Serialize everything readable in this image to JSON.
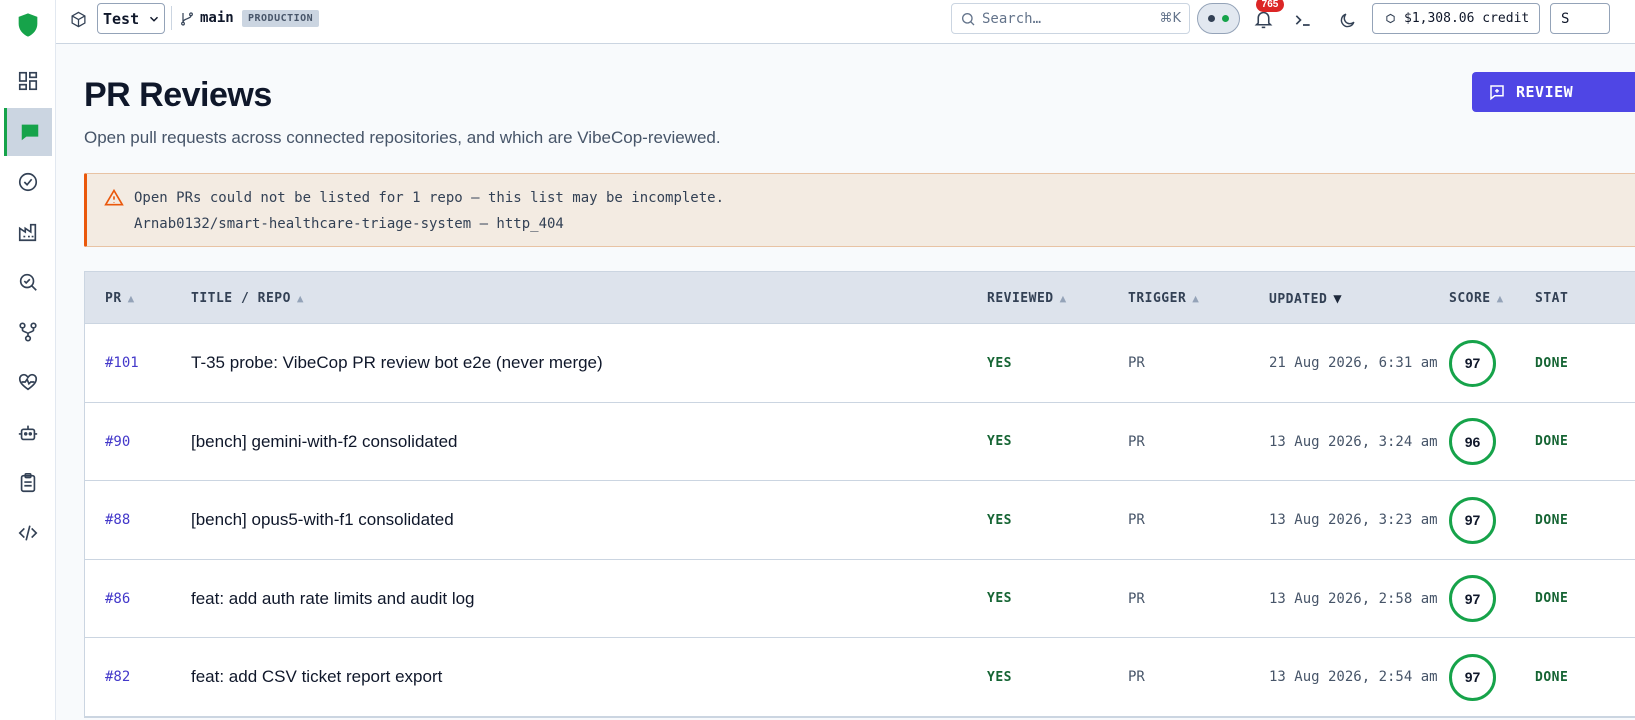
{
  "topbar": {
    "project": "Test",
    "branch": "main",
    "environment": "PRODUCTION",
    "search_placeholder": "Search…",
    "search_shortcut": "⌘K",
    "notification_count": "765",
    "credit": "$1,308.06 credit",
    "user_initial": "S"
  },
  "page": {
    "title": "PR Reviews",
    "subtitle": "Open pull requests across connected repositories, and which are VibeCop-reviewed.",
    "review_button": "REVIEW"
  },
  "alert": {
    "message": "Open PRs could not be listed for 1 repo — this list may be incomplete.",
    "detail": "Arnab0132/smart-healthcare-triage-system — http_404"
  },
  "table": {
    "columns": [
      "PR",
      "TITLE / REPO",
      "REVIEWED",
      "TRIGGER",
      "UPDATED",
      "SCORE",
      "STAT"
    ],
    "rows": [
      {
        "pr": "#101",
        "title": "T-35 probe: VibeCop PR review bot e2e (never merge)",
        "reviewed": "YES",
        "trigger": "PR",
        "updated": "21 Aug 2026, 6:31 am",
        "score": "97",
        "status": "DONE"
      },
      {
        "pr": "#90",
        "title": "[bench] gemini-with-f2 consolidated",
        "reviewed": "YES",
        "trigger": "PR",
        "updated": "13 Aug 2026, 3:24 am",
        "score": "96",
        "status": "DONE"
      },
      {
        "pr": "#88",
        "title": "[bench] opus5-with-f1 consolidated",
        "reviewed": "YES",
        "trigger": "PR",
        "updated": "13 Aug 2026, 3:23 am",
        "score": "97",
        "status": "DONE"
      },
      {
        "pr": "#86",
        "title": "feat: add auth rate limits and audit log",
        "reviewed": "YES",
        "trigger": "PR",
        "updated": "13 Aug 2026, 2:58 am",
        "score": "97",
        "status": "DONE"
      },
      {
        "pr": "#82",
        "title": "feat: add CSV ticket report export",
        "reviewed": "YES",
        "trigger": "PR",
        "updated": "13 Aug 2026, 2:54 am",
        "score": "97",
        "status": "DONE"
      }
    ]
  },
  "colors": {
    "accent": "#4f46e5",
    "success": "#16a34a",
    "warning": "#ea580c",
    "danger": "#dc2626"
  },
  "icons": {
    "sidebar": [
      "dashboard-icon",
      "chat-icon",
      "check-circle-icon",
      "factory-icon",
      "search-check-icon",
      "git-fork-icon",
      "heart-pulse-icon",
      "bot-icon",
      "clipboard-icon",
      "code-icon"
    ]
  }
}
